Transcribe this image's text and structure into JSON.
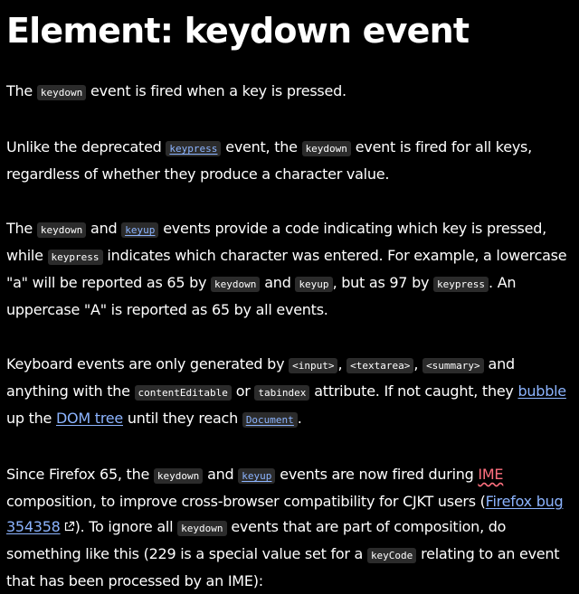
{
  "title": "Element: keydown event",
  "p1": {
    "t1": "The ",
    "c1": "keydown",
    "t2": " event is fired when a key is pressed."
  },
  "p2": {
    "t1": "Unlike the deprecated ",
    "c1": "keypress",
    "t2": " event, the ",
    "c2": "keydown",
    "t3": " event is fired for all keys, regardless of whether they produce a character value."
  },
  "p3": {
    "t1": "The ",
    "c1": "keydown",
    "t2": " and ",
    "c2": "keyup",
    "t3": " events provide a code indicating which key is pressed, while ",
    "c3": "keypress",
    "t4": " indicates which character was entered. For example, a lowercase \"a\" will be reported as 65 by ",
    "c4": "keydown",
    "t5": " and ",
    "c5": "keyup",
    "t6": ", but as 97 by ",
    "c6": "keypress",
    "t7": ". An uppercase \"A\" is reported as 65 by all events."
  },
  "p4": {
    "t1": "Keyboard events are only generated by ",
    "c1": "<input>",
    "s1": ", ",
    "c2": "<textarea>",
    "s2": ", ",
    "c3": "<summary>",
    "t2": " and anything with the ",
    "c4": "contentEditable",
    "t3": " or ",
    "c5": "tabindex",
    "t4": " attribute. If not caught, they ",
    "l1": "bubble",
    "t5": " up the ",
    "l2": "DOM tree",
    "t6": " until they reach ",
    "c6": "Document",
    "t7": "."
  },
  "p5": {
    "t1": "Since Firefox 65, the ",
    "c1": "keydown",
    "t2": " and ",
    "c2": "keyup",
    "t3": " events are now fired during ",
    "ime": "IME",
    "t4": " composition, to improve cross-browser compatibility for CJKT users (",
    "l1": "Firefox bug 354358",
    "t5": "). To ignore all ",
    "c3": "keydown",
    "t6": " events that are part of composition, do something like this (229 is a special value set for a ",
    "c4": "keyCode",
    "t7": " relating to an event that has been processed by an IME):"
  },
  "colors": {
    "background": "#000000",
    "text": "#ffffff",
    "link": "#8cb4ff",
    "code_bg": "#2b2b2b",
    "ime": "#ff707f"
  },
  "icons": {
    "external_link": "external-link-icon"
  }
}
